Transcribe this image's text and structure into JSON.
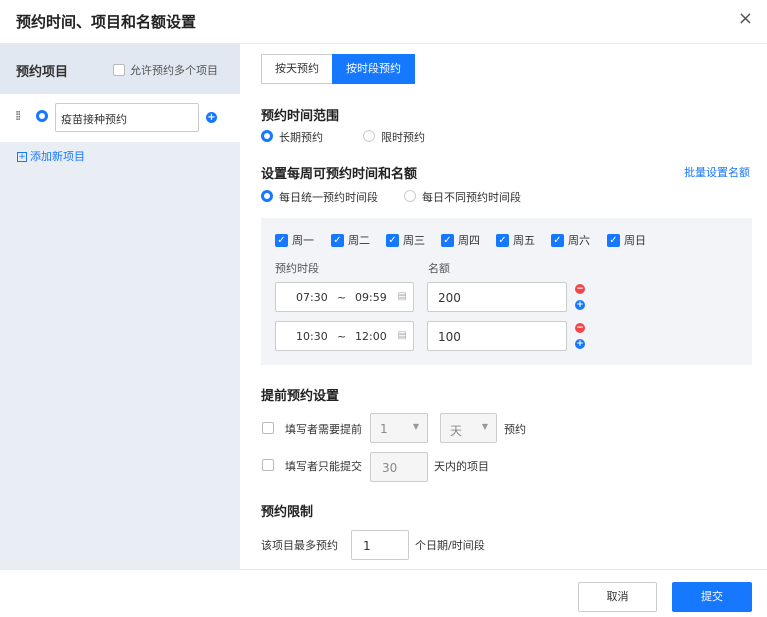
{
  "dialog": {
    "title": "预约时间、项目和名额设置",
    "close_icon": "×"
  },
  "sidebar": {
    "title": "预约项目",
    "allow_multiple_label": "允许预约多个项目",
    "project_value": "疫苗接种预约",
    "add_new_label": "添加新项目"
  },
  "tabs": [
    "按天预约",
    "按时段预约"
  ],
  "range": {
    "title": "预约时间范围",
    "options": [
      "长期预约",
      "限时预约"
    ],
    "selected": "长期预约"
  },
  "weekly": {
    "title": "设置每周可预约时间和名额",
    "batch_link": "批量设置名额",
    "options": [
      "每日统一预约时间段",
      "每日不同预约时间段"
    ],
    "selected": "每日统一预约时间段",
    "days": [
      "周一",
      "周二",
      "周三",
      "周四",
      "周五",
      "周六",
      "周日"
    ],
    "slot_label": "预约时段",
    "quota_label": "名额",
    "slots": [
      {
        "start": "07:30",
        "end": "09:59",
        "quota": "200"
      },
      {
        "start": "10:30",
        "end": "12:00",
        "quota": "100"
      }
    ],
    "sep": "~"
  },
  "advance": {
    "title": "提前预约设置",
    "row1": {
      "label": "填写者需要提前",
      "num": "1",
      "unit": "天",
      "suffix": "预约"
    },
    "row2": {
      "label": "填写者只能提交",
      "num": "30",
      "suffix": "天内的项目"
    }
  },
  "limit": {
    "title": "预约限制",
    "label": "该项目最多预约",
    "value": "1",
    "suffix": "个日期/时间段"
  },
  "footer": {
    "cancel": "取消",
    "submit": "提交"
  },
  "colors": {
    "accent": "#1677ff",
    "danger": "#f04848",
    "sidebar_bg": "#e9eef5",
    "panel_bg": "#f2f4f7"
  }
}
